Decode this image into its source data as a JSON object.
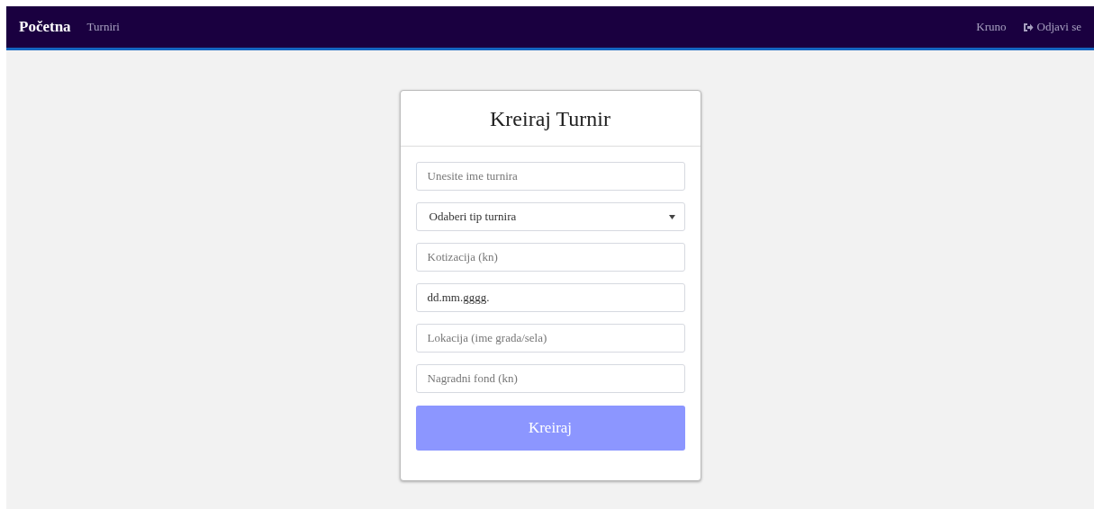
{
  "navbar": {
    "brand": "Početna",
    "links": [
      {
        "label": "Turniri"
      }
    ],
    "user": "Kruno",
    "logout": "Odjavi se"
  },
  "form": {
    "title": "Kreiraj Turnir",
    "fields": [
      {
        "kind": "text",
        "placeholder": "Unesite ime turnira"
      },
      {
        "kind": "select",
        "value": "Odaberi tip turnira"
      },
      {
        "kind": "text",
        "placeholder": "Kotizacija (kn)"
      },
      {
        "kind": "date",
        "placeholder": "dd.mm.gggg."
      },
      {
        "kind": "text",
        "placeholder": "Lokacija (ime grada/sela)"
      },
      {
        "kind": "text",
        "placeholder": "Nagradni fond (kn)"
      }
    ],
    "submit": "Kreiraj"
  }
}
